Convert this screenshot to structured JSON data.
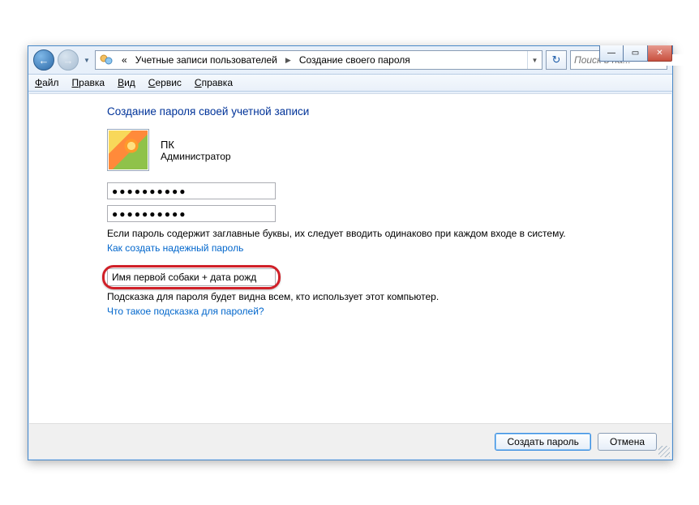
{
  "titlebar": {
    "minimize": "—",
    "maximize": "▭",
    "close": "✕"
  },
  "nav": {
    "back": "←",
    "forward": "→"
  },
  "breadcrumb": {
    "prefix": "«",
    "seg1": "Учетные записи пользователей",
    "seg2": "Создание своего пароля"
  },
  "search": {
    "placeholder": "Поиск в па..."
  },
  "menu": {
    "file": "айл",
    "edit": "равка",
    "view": "ид",
    "tools": "ервис",
    "help": "правка"
  },
  "content": {
    "heading": "Создание пароля своей учетной записи",
    "username": "ПК",
    "role": "Администратор",
    "password1": "●●●●●●●●●●",
    "password2": "●●●●●●●●●●",
    "case_warning": "Если пароль содержит заглавные буквы, их следует вводить одинаково при каждом входе в систему.",
    "strong_link": "Как создать надежный пароль",
    "hint_value": "Имя первой собаки + дата рожд",
    "hint_visibility": "Подсказка для пароля будет видна всем, кто использует этот компьютер.",
    "hint_link": "Что такое подсказка для паролей?"
  },
  "footer": {
    "create": "Создать пароль",
    "cancel": "Отмена"
  }
}
